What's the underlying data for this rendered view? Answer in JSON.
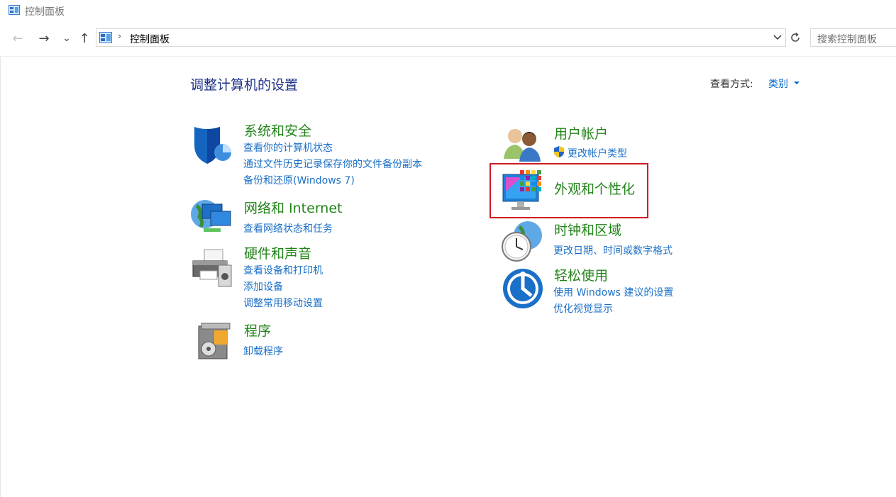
{
  "window": {
    "title": "控制面板"
  },
  "nav": {
    "back_glyph": "←",
    "forward_glyph": "→",
    "recent_glyph": "⌄",
    "up_glyph": "↑",
    "breadcrumb_sep": "›",
    "breadcrumb": "控制面板",
    "search_placeholder": "搜索控制面板"
  },
  "main": {
    "heading": "调整计算机的设置",
    "view_by_label": "查看方式:",
    "view_by_value": "类别"
  },
  "categories": [
    {
      "title": "系统和安全",
      "links": [
        "查看你的计算机状态",
        "通过文件历史记录保存你的文件备份副本",
        "备份和还原(Windows 7)"
      ]
    },
    {
      "title": "网络和 Internet",
      "links": [
        "查看网络状态和任务"
      ]
    },
    {
      "title": "硬件和声音",
      "links": [
        "查看设备和打印机",
        "添加设备",
        "调整常用移动设置"
      ]
    },
    {
      "title": "程序",
      "links": [
        "卸载程序"
      ]
    },
    {
      "title": "用户帐户",
      "links": [
        "更改帐户类型"
      ]
    },
    {
      "title": "外观和个性化",
      "links": []
    },
    {
      "title": "时钟和区域",
      "links": [
        "更改日期、时间或数字格式"
      ]
    },
    {
      "title": "轻松使用",
      "links": [
        "使用 Windows 建议的设置",
        "优化视觉显示"
      ]
    }
  ],
  "colors": {
    "heading": "#1e3287",
    "category_title": "#23841a",
    "link": "#1a6fc7",
    "highlight_box": "#d01b24"
  }
}
